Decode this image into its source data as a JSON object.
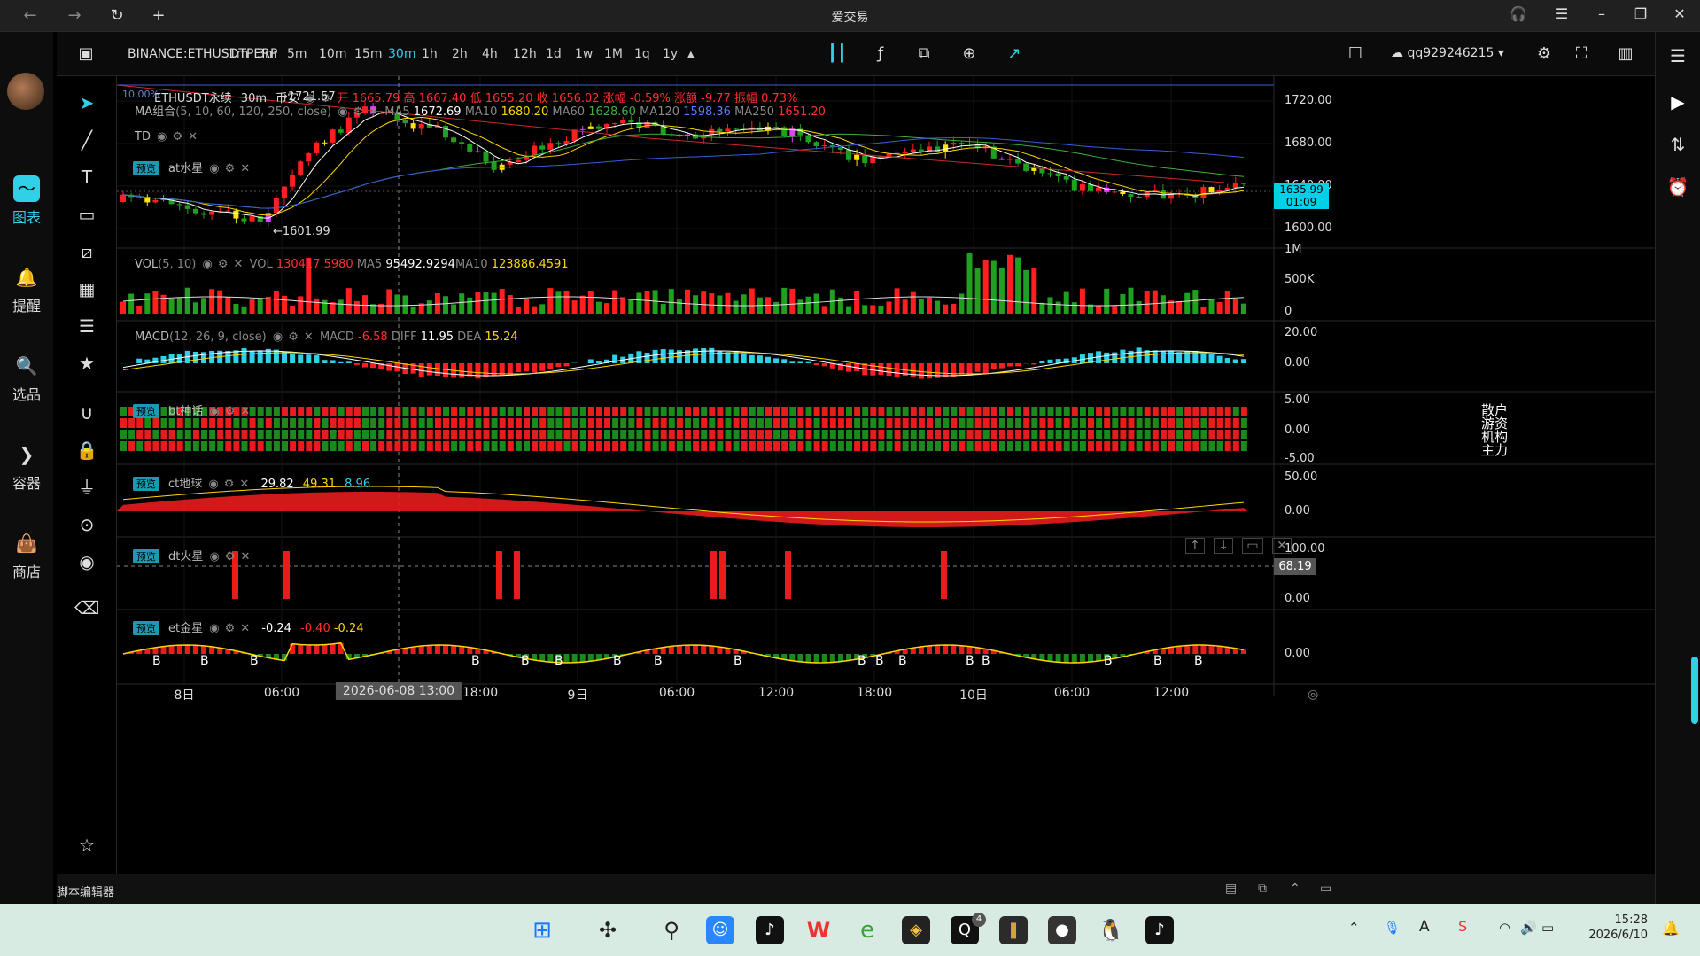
{
  "window": {
    "title": "爱交易",
    "back": "←",
    "forward": "→",
    "refresh": "↻",
    "new_tab": "+",
    "headset": "🎧",
    "menu": "☰",
    "min": "–",
    "max": "❐",
    "close": "✕"
  },
  "leftnav": [
    {
      "label": "图表",
      "icon": "chart-icon"
    },
    {
      "label": "提醒",
      "icon": "bell-icon"
    },
    {
      "label": "选品",
      "icon": "magnifier-chart-icon"
    },
    {
      "label": "容器",
      "icon": "diamond-arrow-icon"
    },
    {
      "label": "商店",
      "icon": "shop-bag-icon"
    }
  ],
  "toolbar": {
    "symbol": "BINANCE:ETHUSDTPERP",
    "timeframes": [
      "1m",
      "3m",
      "5m",
      "10m",
      "15m",
      "30m",
      "1h",
      "2h",
      "4h",
      "12h",
      "1d",
      "1w",
      "1M",
      "1q",
      "1y"
    ],
    "active_timeframe": "30m",
    "user": "qq929246215"
  },
  "legend": {
    "main": {
      "name": "ETHUSDT永续",
      "tf": "30m",
      "exchange": "币安",
      "open_label": "开",
      "open": "1665.79",
      "high_label": "高",
      "high": "1667.40",
      "low_label": "低",
      "low": "1655.20",
      "close_label": "收",
      "close": "1656.02",
      "chg_label": "涨幅",
      "chg": "-0.59%",
      "chgamt_label": "涨额",
      "chgamt": "-9.77",
      "amp_label": "振幅",
      "amp": "0.73%",
      "watermark": "10.00%",
      "high_marker": "→1721.57",
      "low_marker": "←1601.99"
    },
    "ma": {
      "name": "MA组合",
      "params": "(5, 10, 60, 120, 250, close)",
      "ma5_label": "MA5",
      "ma5": "1672.69",
      "ma10_label": "MA10",
      "ma10": "1680.20",
      "ma60_label": "MA60",
      "ma60": "1628.60",
      "ma120_label": "MA120",
      "ma120": "1598.36",
      "ma250_label": "MA250",
      "ma250": "1651.20"
    },
    "td": {
      "name": "TD"
    },
    "at": {
      "badge": "预览",
      "name": "at水星"
    },
    "vol": {
      "name": "VOL",
      "params": "(5, 10)",
      "vol_label": "VOL",
      "vol": "130417.5980",
      "ma5_label": "MA5",
      "ma5": "95492.9294",
      "ma10_label": "MA10",
      "ma10": "123886.4591"
    },
    "macd": {
      "name": "MACD",
      "params": "(12, 26, 9, close)",
      "macd_label": "MACD",
      "macd": "-6.58",
      "dif_label": "DIFF",
      "dif": "11.95",
      "dea_label": "DEA",
      "dea": "15.24"
    },
    "bt": {
      "badge": "预览",
      "name": "bt神话",
      "rows": [
        "散户",
        "游资",
        "机构",
        "主力"
      ]
    },
    "ct": {
      "badge": "预览",
      "name": "ct地球",
      "v1": "29.82",
      "v2": "49.31",
      "v3": "8.96"
    },
    "dt": {
      "badge": "预览",
      "name": "dt火星"
    },
    "et": {
      "badge": "预览",
      "name": "et金星",
      "v1": "-0.24",
      "v2": "-0.40",
      "v3": "-0.24"
    }
  },
  "price_axis": {
    "main": [
      "1720.00",
      "1680.00",
      "1640.00",
      "1600.00"
    ],
    "current_price": "1635.99",
    "countdown": "01:09",
    "vol": [
      "1M",
      "500K",
      "0"
    ],
    "macd": [
      "20.00",
      "0.00"
    ],
    "bt": [
      "5.00",
      "0.00",
      "-5.00"
    ],
    "ct": [
      "50.00",
      "0.00"
    ],
    "dt": [
      "100.00",
      "68.19",
      "0.00"
    ],
    "et": [
      "0.00"
    ]
  },
  "time_axis": {
    "labels": [
      "8日",
      "06:00",
      "2026-06-08  13:00",
      "18:00",
      "9日",
      "06:00",
      "12:00",
      "18:00",
      "10日",
      "06:00",
      "12:00"
    ]
  },
  "script_editor": {
    "label": "脚本编辑器"
  },
  "taskbar": {
    "time": "15:28",
    "date": "2026/6/10",
    "qq_badge": "4"
  },
  "colors": {
    "up": "#ff1f1f",
    "down": "#1fa01f",
    "accent": "#2fd0e8",
    "ma5": "#ffffff",
    "ma10": "#ffd700",
    "ma60": "#3fae3f",
    "ma120": "#3a5bd9",
    "ma250": "#cc2a2a",
    "dea": "#ffd700"
  }
}
